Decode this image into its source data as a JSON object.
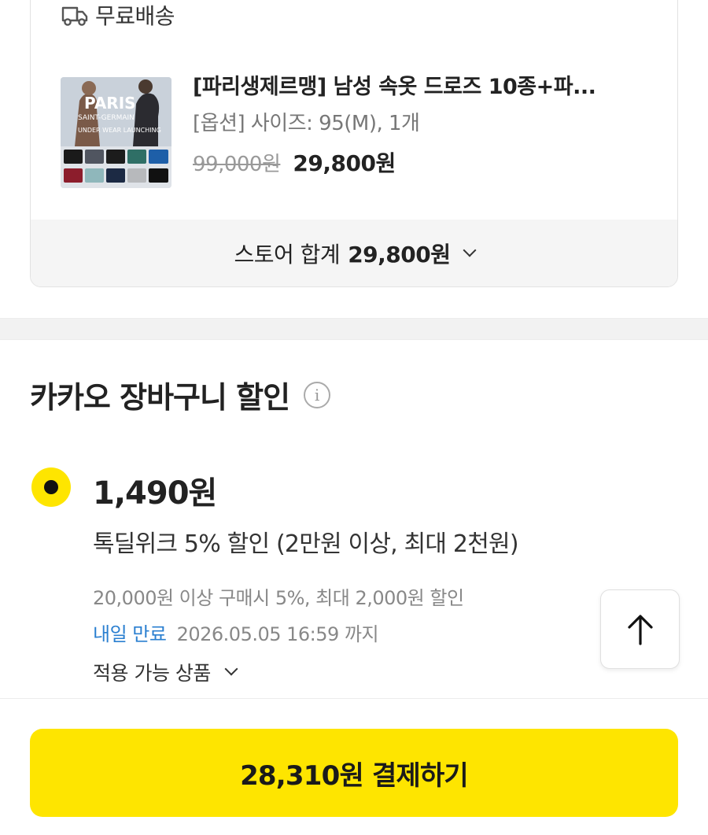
{
  "shipping": {
    "label": "무료배송",
    "icon": "truck-icon"
  },
  "product": {
    "title": "[파리생제르맹] 남성 속옷 드로즈 10종+파...",
    "option": "[옵션] 사이즈: 95(M), 1개",
    "original_price": "99,000원",
    "sale_price": "29,800원",
    "image_text": {
      "brand": "PARIS",
      "sub": "SAINT-GERMAIN",
      "tag": "UNDER WEAR LAUNCHING"
    }
  },
  "store_total": {
    "label": "스토어 합계",
    "amount": "29,800원"
  },
  "discount_section": {
    "title": "카카오 장바구니 할인",
    "coupon": {
      "amount": "1,490원",
      "name": "톡딜위크 5% 할인 (2만원 이상, 최대 2천원)",
      "condition": "20,000원 이상 구매시 5%, 최대 2,000원 할인",
      "expire_badge": "내일 만료",
      "expire_date": "2026.05.05 16:59 까지",
      "applicable_label": "적용 가능 상품"
    }
  },
  "pay_button": {
    "label": "28,310원 결제하기"
  },
  "colors": {
    "accent": "#fee500",
    "link": "#2a7fd0"
  }
}
